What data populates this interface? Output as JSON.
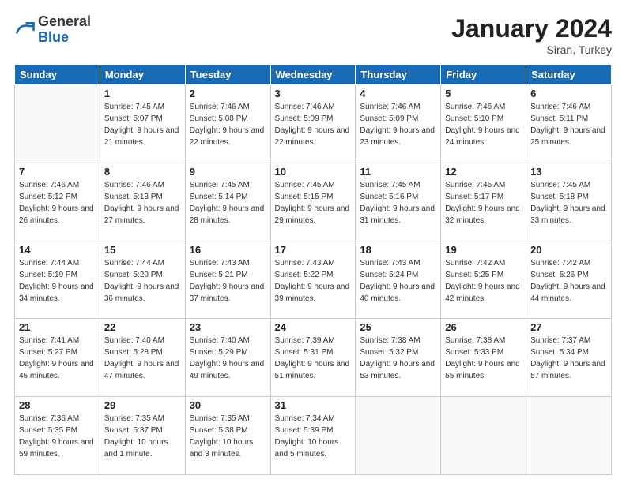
{
  "header": {
    "logo_general": "General",
    "logo_blue": "Blue",
    "month_title": "January 2024",
    "location": "Siran, Turkey"
  },
  "weekdays": [
    "Sunday",
    "Monday",
    "Tuesday",
    "Wednesday",
    "Thursday",
    "Friday",
    "Saturday"
  ],
  "weeks": [
    [
      {
        "day": "",
        "sunrise": "",
        "sunset": "",
        "daylight": ""
      },
      {
        "day": "1",
        "sunrise": "Sunrise: 7:45 AM",
        "sunset": "Sunset: 5:07 PM",
        "daylight": "Daylight: 9 hours and 21 minutes."
      },
      {
        "day": "2",
        "sunrise": "Sunrise: 7:46 AM",
        "sunset": "Sunset: 5:08 PM",
        "daylight": "Daylight: 9 hours and 22 minutes."
      },
      {
        "day": "3",
        "sunrise": "Sunrise: 7:46 AM",
        "sunset": "Sunset: 5:09 PM",
        "daylight": "Daylight: 9 hours and 22 minutes."
      },
      {
        "day": "4",
        "sunrise": "Sunrise: 7:46 AM",
        "sunset": "Sunset: 5:09 PM",
        "daylight": "Daylight: 9 hours and 23 minutes."
      },
      {
        "day": "5",
        "sunrise": "Sunrise: 7:46 AM",
        "sunset": "Sunset: 5:10 PM",
        "daylight": "Daylight: 9 hours and 24 minutes."
      },
      {
        "day": "6",
        "sunrise": "Sunrise: 7:46 AM",
        "sunset": "Sunset: 5:11 PM",
        "daylight": "Daylight: 9 hours and 25 minutes."
      }
    ],
    [
      {
        "day": "7",
        "sunrise": "Sunrise: 7:46 AM",
        "sunset": "Sunset: 5:12 PM",
        "daylight": "Daylight: 9 hours and 26 minutes."
      },
      {
        "day": "8",
        "sunrise": "Sunrise: 7:46 AM",
        "sunset": "Sunset: 5:13 PM",
        "daylight": "Daylight: 9 hours and 27 minutes."
      },
      {
        "day": "9",
        "sunrise": "Sunrise: 7:45 AM",
        "sunset": "Sunset: 5:14 PM",
        "daylight": "Daylight: 9 hours and 28 minutes."
      },
      {
        "day": "10",
        "sunrise": "Sunrise: 7:45 AM",
        "sunset": "Sunset: 5:15 PM",
        "daylight": "Daylight: 9 hours and 29 minutes."
      },
      {
        "day": "11",
        "sunrise": "Sunrise: 7:45 AM",
        "sunset": "Sunset: 5:16 PM",
        "daylight": "Daylight: 9 hours and 31 minutes."
      },
      {
        "day": "12",
        "sunrise": "Sunrise: 7:45 AM",
        "sunset": "Sunset: 5:17 PM",
        "daylight": "Daylight: 9 hours and 32 minutes."
      },
      {
        "day": "13",
        "sunrise": "Sunrise: 7:45 AM",
        "sunset": "Sunset: 5:18 PM",
        "daylight": "Daylight: 9 hours and 33 minutes."
      }
    ],
    [
      {
        "day": "14",
        "sunrise": "Sunrise: 7:44 AM",
        "sunset": "Sunset: 5:19 PM",
        "daylight": "Daylight: 9 hours and 34 minutes."
      },
      {
        "day": "15",
        "sunrise": "Sunrise: 7:44 AM",
        "sunset": "Sunset: 5:20 PM",
        "daylight": "Daylight: 9 hours and 36 minutes."
      },
      {
        "day": "16",
        "sunrise": "Sunrise: 7:43 AM",
        "sunset": "Sunset: 5:21 PM",
        "daylight": "Daylight: 9 hours and 37 minutes."
      },
      {
        "day": "17",
        "sunrise": "Sunrise: 7:43 AM",
        "sunset": "Sunset: 5:22 PM",
        "daylight": "Daylight: 9 hours and 39 minutes."
      },
      {
        "day": "18",
        "sunrise": "Sunrise: 7:43 AM",
        "sunset": "Sunset: 5:24 PM",
        "daylight": "Daylight: 9 hours and 40 minutes."
      },
      {
        "day": "19",
        "sunrise": "Sunrise: 7:42 AM",
        "sunset": "Sunset: 5:25 PM",
        "daylight": "Daylight: 9 hours and 42 minutes."
      },
      {
        "day": "20",
        "sunrise": "Sunrise: 7:42 AM",
        "sunset": "Sunset: 5:26 PM",
        "daylight": "Daylight: 9 hours and 44 minutes."
      }
    ],
    [
      {
        "day": "21",
        "sunrise": "Sunrise: 7:41 AM",
        "sunset": "Sunset: 5:27 PM",
        "daylight": "Daylight: 9 hours and 45 minutes."
      },
      {
        "day": "22",
        "sunrise": "Sunrise: 7:40 AM",
        "sunset": "Sunset: 5:28 PM",
        "daylight": "Daylight: 9 hours and 47 minutes."
      },
      {
        "day": "23",
        "sunrise": "Sunrise: 7:40 AM",
        "sunset": "Sunset: 5:29 PM",
        "daylight": "Daylight: 9 hours and 49 minutes."
      },
      {
        "day": "24",
        "sunrise": "Sunrise: 7:39 AM",
        "sunset": "Sunset: 5:31 PM",
        "daylight": "Daylight: 9 hours and 51 minutes."
      },
      {
        "day": "25",
        "sunrise": "Sunrise: 7:38 AM",
        "sunset": "Sunset: 5:32 PM",
        "daylight": "Daylight: 9 hours and 53 minutes."
      },
      {
        "day": "26",
        "sunrise": "Sunrise: 7:38 AM",
        "sunset": "Sunset: 5:33 PM",
        "daylight": "Daylight: 9 hours and 55 minutes."
      },
      {
        "day": "27",
        "sunrise": "Sunrise: 7:37 AM",
        "sunset": "Sunset: 5:34 PM",
        "daylight": "Daylight: 9 hours and 57 minutes."
      }
    ],
    [
      {
        "day": "28",
        "sunrise": "Sunrise: 7:36 AM",
        "sunset": "Sunset: 5:35 PM",
        "daylight": "Daylight: 9 hours and 59 minutes."
      },
      {
        "day": "29",
        "sunrise": "Sunrise: 7:35 AM",
        "sunset": "Sunset: 5:37 PM",
        "daylight": "Daylight: 10 hours and 1 minute."
      },
      {
        "day": "30",
        "sunrise": "Sunrise: 7:35 AM",
        "sunset": "Sunset: 5:38 PM",
        "daylight": "Daylight: 10 hours and 3 minutes."
      },
      {
        "day": "31",
        "sunrise": "Sunrise: 7:34 AM",
        "sunset": "Sunset: 5:39 PM",
        "daylight": "Daylight: 10 hours and 5 minutes."
      },
      {
        "day": "",
        "sunrise": "",
        "sunset": "",
        "daylight": ""
      },
      {
        "day": "",
        "sunrise": "",
        "sunset": "",
        "daylight": ""
      },
      {
        "day": "",
        "sunrise": "",
        "sunset": "",
        "daylight": ""
      }
    ]
  ]
}
